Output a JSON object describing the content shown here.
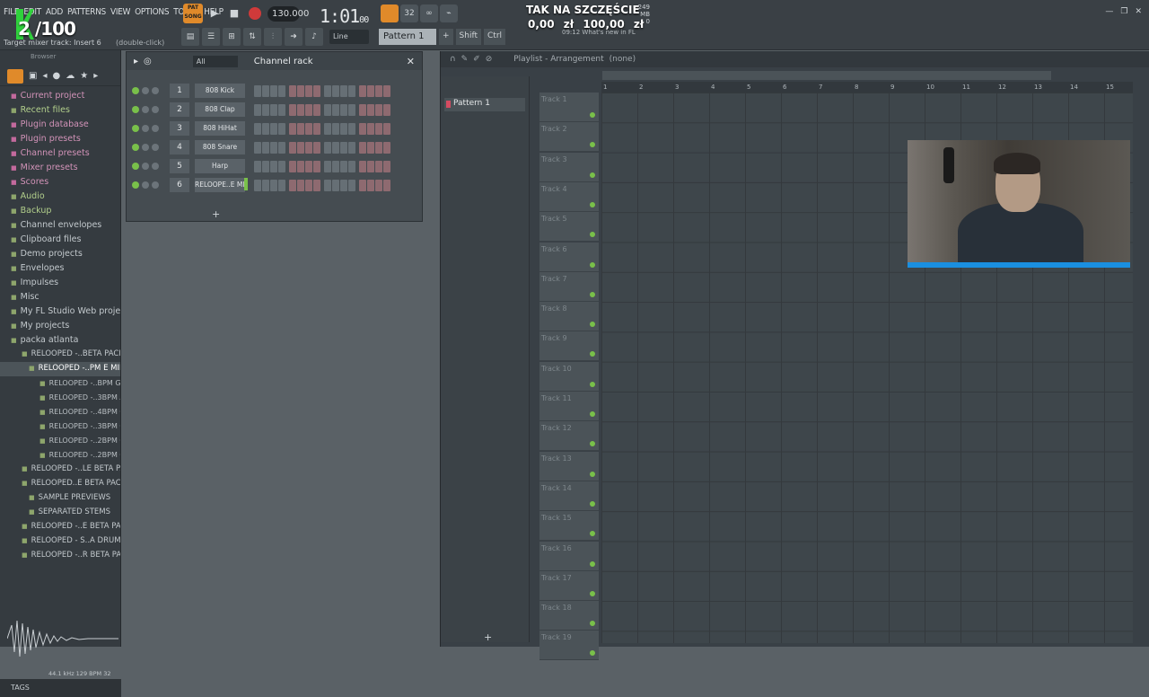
{
  "menu": [
    "FILE",
    "EDIT",
    "ADD",
    "PATTERNS",
    "VIEW",
    "OPTIONS",
    "TOOLS",
    "HELP"
  ],
  "hint": "Target mixer track: Insert 6",
  "hint2": "(double-click)",
  "overlay": {
    "counter": "2 /100"
  },
  "transport": {
    "pat_label": "PAT SONG",
    "tempo": "130.000",
    "time": "1:01",
    "time_sub": "00",
    "time_top": "B:S:T"
  },
  "memory": {
    "mb": "249 MB",
    "value": "0"
  },
  "promo": {
    "title": "TAK NA SZCZĘŚCIE",
    "left_val": "0,00 zł",
    "right_val": "100,00 zł"
  },
  "news": {
    "time": "09:12",
    "text": "What's new in FL"
  },
  "toolbar": {
    "line": "Line",
    "pattern": "Pattern 1",
    "shift": "Shift",
    "ctrl": "Ctrl"
  },
  "browser": {
    "header": "Browser",
    "items": [
      {
        "label": "Current project",
        "cls": "pink"
      },
      {
        "label": "Recent files",
        "cls": "green"
      },
      {
        "label": "Plugin database",
        "cls": "pink"
      },
      {
        "label": "Plugin presets",
        "cls": "pink"
      },
      {
        "label": "Channel presets",
        "cls": "pink"
      },
      {
        "label": "Mixer presets",
        "cls": "pink"
      },
      {
        "label": "Scores",
        "cls": "pink"
      },
      {
        "label": "Audio",
        "cls": "green"
      },
      {
        "label": "Backup",
        "cls": "green"
      },
      {
        "label": "Channel envelopes",
        "cls": ""
      },
      {
        "label": "Clipboard files",
        "cls": ""
      },
      {
        "label": "Demo projects",
        "cls": ""
      },
      {
        "label": "Envelopes",
        "cls": ""
      },
      {
        "label": "Impulses",
        "cls": ""
      },
      {
        "label": "Misc",
        "cls": ""
      },
      {
        "label": "My FL Studio Web projects",
        "cls": ""
      },
      {
        "label": "My projects",
        "cls": ""
      },
      {
        "label": "packa atlanta",
        "cls": ""
      },
      {
        "label": "RELOOPED -..BETA PACK",
        "cls": "sub"
      },
      {
        "label": "RELOOPED -..PM E MIN",
        "cls": "sub2 sel"
      },
      {
        "label": "RELOOPED -..BPM G MIN",
        "cls": "sub3"
      },
      {
        "label": "RELOOPED -..3BPM A MIN",
        "cls": "sub3"
      },
      {
        "label": "RELOOPED -..4BPM C MIN",
        "cls": "sub3"
      },
      {
        "label": "RELOOPED -..3BPM C MIN",
        "cls": "sub3"
      },
      {
        "label": "RELOOPED -..2BPM G MIN",
        "cls": "sub3"
      },
      {
        "label": "RELOOPED -..2BPM C MIN",
        "cls": "sub3"
      },
      {
        "label": "RELOOPED -..LE BETA PACK",
        "cls": "sub"
      },
      {
        "label": "RELOOPED..E BETA PACK",
        "cls": "sub"
      },
      {
        "label": "SAMPLE PREVIEWS",
        "cls": "sub2"
      },
      {
        "label": "SEPARATED STEMS",
        "cls": "sub2"
      },
      {
        "label": "RELOOPED -..E BETA PACK",
        "cls": "sub"
      },
      {
        "label": "RELOOPED - S..A DRUM KIT",
        "cls": "sub"
      },
      {
        "label": "RELOOPED -..R BETA PACK",
        "cls": "sub"
      }
    ],
    "wave_info": "44.1 kHz 129 BPM 32",
    "tags": "TAGS"
  },
  "channel_rack": {
    "filter": "All",
    "title": "Channel rack",
    "channels": [
      {
        "num": "1",
        "name": "808 Kick"
      },
      {
        "num": "2",
        "name": "808 Clap"
      },
      {
        "num": "3",
        "name": "808 HiHat"
      },
      {
        "num": "4",
        "name": "808 Snare"
      },
      {
        "num": "5",
        "name": "Harp"
      },
      {
        "num": "6",
        "name": "RELOOPE..E MIN"
      }
    ]
  },
  "playlist": {
    "title": "Playlist - Arrangement",
    "sub": "(none)",
    "pattern": "Pattern 1",
    "ruler": [
      "1",
      "2",
      "3",
      "4",
      "5",
      "6",
      "7",
      "8",
      "9",
      "10",
      "11",
      "12",
      "13",
      "14",
      "15"
    ],
    "tracks": [
      "Track 1",
      "Track 2",
      "Track 3",
      "Track 4",
      "Track 5",
      "Track 6",
      "Track 7",
      "Track 8",
      "Track 9",
      "Track 10",
      "Track 11",
      "Track 12",
      "Track 13",
      "Track 14",
      "Track 15",
      "Track 16",
      "Track 17",
      "Track 18",
      "Track 19"
    ]
  }
}
